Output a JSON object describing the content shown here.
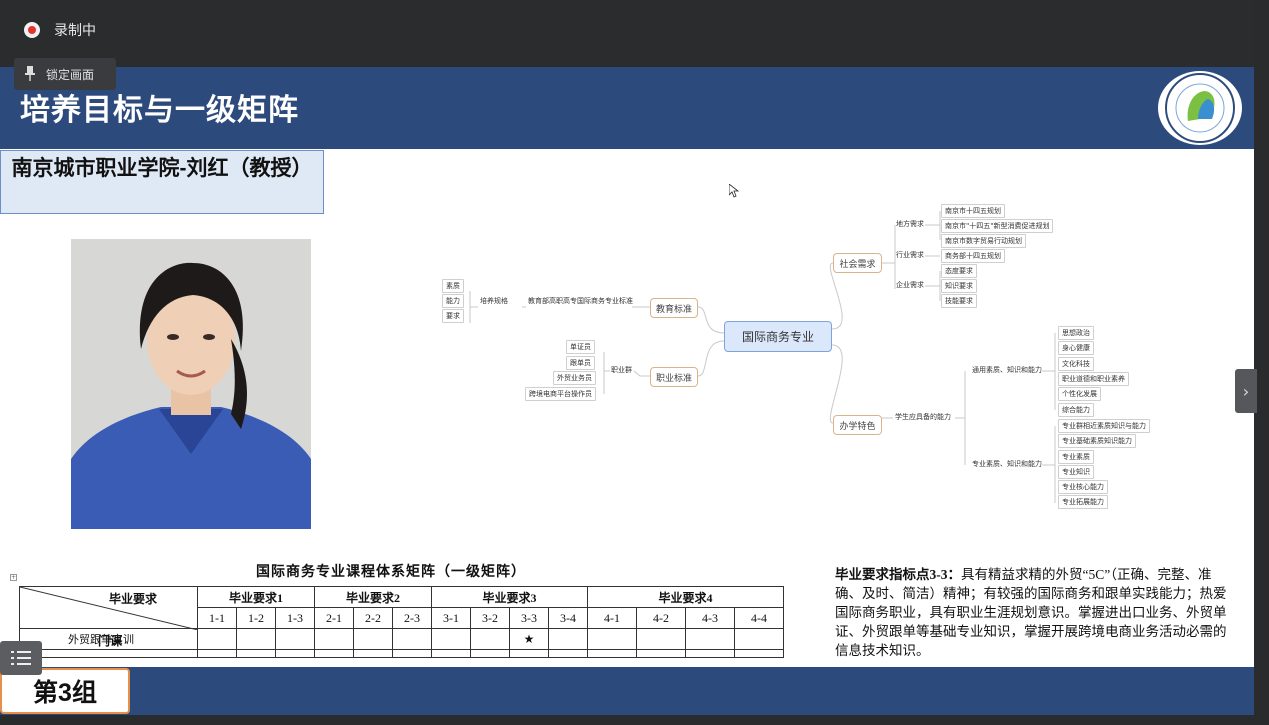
{
  "recording": {
    "status_label": "录制中",
    "lock_label": "锁定画面"
  },
  "slide": {
    "title": "培养目标与一级矩阵",
    "presenter": "南京城市职业学院-刘红（教授）",
    "group_label": "第3组",
    "colors": {
      "header": "#2d4a7c",
      "name_box": "#dfe8f5"
    }
  },
  "mindmap": {
    "center": "国际商务专业",
    "edu_std": {
      "label": "教育标准",
      "branch": "教育部高职高专国际商务专业标准",
      "sub": "培养规格",
      "leaves": [
        "素质",
        "能力",
        "要求"
      ]
    },
    "job_std": {
      "label": "职业标准",
      "sub": "职业群",
      "leaves": [
        "单证员",
        "跟单员",
        "外贸业务员",
        "跨境电商平台操作员"
      ]
    },
    "social": {
      "label": "社会需求",
      "local": {
        "label": "地方需求",
        "leaves": [
          "南京市十四五规划",
          "南京市\"十四五\"新型消费促进规划",
          "南京市数字贸易行动规划"
        ]
      },
      "industry": {
        "label": "行业需求",
        "leaves": [
          "商务部十四五规划"
        ]
      },
      "company": {
        "label": "企业需求",
        "leaves": [
          "态度要求",
          "知识要求",
          "技能要求"
        ]
      }
    },
    "school": {
      "label": "办学特色",
      "sub": "学生应具备的能力",
      "general": {
        "label": "通用素质、知识和能力",
        "leaves": [
          "思想政治",
          "身心健康",
          "文化科技",
          "职业道德和职业素养",
          "个性化发展",
          "综合能力"
        ]
      },
      "major": {
        "label": "专业素质、知识和能力",
        "leaves": [
          "专业群相近素质知识与能力",
          "专业基础素质知识能力",
          "专业素质",
          "专业知识",
          "专业核心能力",
          "专业拓展能力"
        ]
      }
    }
  },
  "matrix": {
    "title": "国际商务专业课程体系矩阵（一级矩阵）",
    "corner_top": "毕业要求",
    "corner_bottom": "门课",
    "groups": [
      "毕业要求1",
      "毕业要求2",
      "毕业要求3",
      "毕业要求4"
    ],
    "subcols": [
      "1-1",
      "1-2",
      "1-3",
      "2-1",
      "2-2",
      "2-3",
      "3-1",
      "3-2",
      "3-3",
      "3-4",
      "4-1",
      "4-2",
      "4-3",
      "4-4"
    ],
    "rows": [
      {
        "course": "外贸跟单实训",
        "marks": [
          "",
          "",
          "",
          "",
          "",
          "",
          "",
          "",
          "★",
          "",
          "",
          "",
          "",
          ""
        ]
      }
    ]
  },
  "indicator": {
    "label": "毕业要求指标点3-3：",
    "text": "具有精益求精的外贸“5C”（正确、完整、准确、及时、简洁）精神；有较强的国际商务和跟单实践能力；热爱国际商务职业，具有职业生涯规划意识。掌握进出口业务、外贸单证、外贸跟单等基础专业知识，掌握开展跨境电商业务活动必需的信息技术知识。"
  },
  "icons": [
    "record-icon",
    "pin-icon",
    "list-icon",
    "chevron-right-icon",
    "cursor-icon",
    "logo-icon"
  ]
}
